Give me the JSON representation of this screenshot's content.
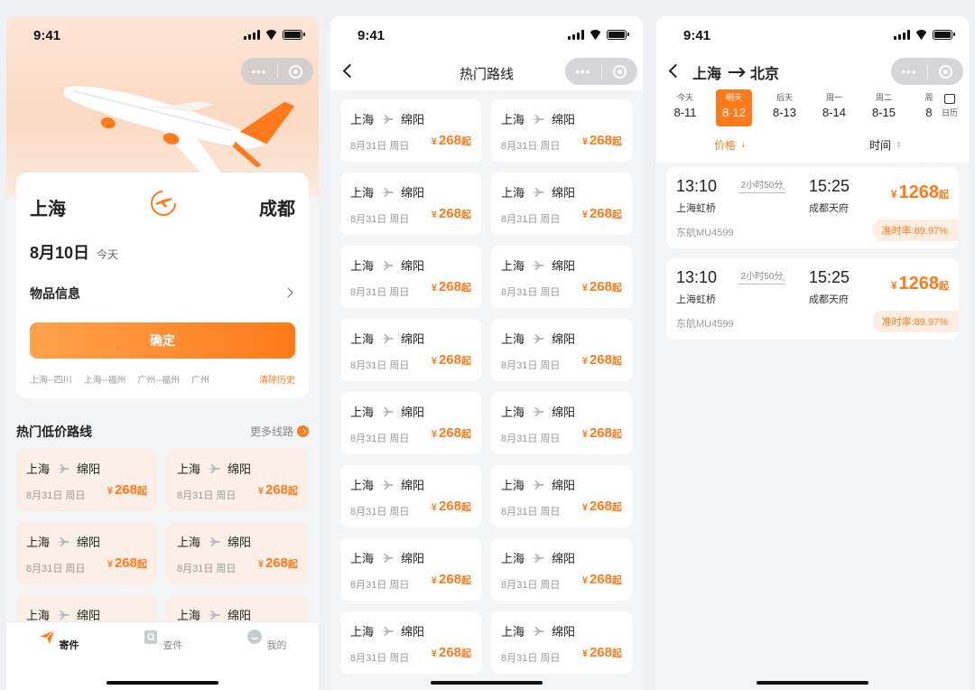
{
  "status": {
    "time": "9:41"
  },
  "colors": {
    "accent": "#ff7a1a",
    "accent_light": "#fbefe7"
  },
  "home": {
    "from_city": "上海",
    "to_city": "成都",
    "date": "8月10日",
    "date_sub": "今天",
    "goods_label": "物品信息",
    "confirm_label": "确定",
    "history": [
      "上海--四川",
      "上海--福州",
      "广州--福州",
      "广州"
    ],
    "clear_history": "清除历史",
    "section_title": "热门低价路线",
    "more_label": "更多线路",
    "routes": [
      {
        "from": "上海",
        "to": "绵阳",
        "date": "8月31日 周日",
        "currency": "¥",
        "price": "268",
        "suffix": "起"
      },
      {
        "from": "上海",
        "to": "绵阳",
        "date": "8月31日 周日",
        "currency": "¥",
        "price": "268",
        "suffix": "起"
      },
      {
        "from": "上海",
        "to": "绵阳",
        "date": "8月31日 周日",
        "currency": "¥",
        "price": "268",
        "suffix": "起"
      },
      {
        "from": "上海",
        "to": "绵阳",
        "date": "8月31日 周日",
        "currency": "¥",
        "price": "268",
        "suffix": "起"
      },
      {
        "from": "上海",
        "to": "绵阳",
        "date": "",
        "currency": "",
        "price": "",
        "suffix": ""
      },
      {
        "from": "上海",
        "to": "绵阳",
        "date": "",
        "currency": "",
        "price": "",
        "suffix": ""
      }
    ],
    "tabs": [
      {
        "label": "寄件",
        "icon": "send-plane-icon"
      },
      {
        "label": "查件",
        "icon": "search-package-icon"
      },
      {
        "label": "我的",
        "icon": "profile-face-icon"
      }
    ]
  },
  "hot_routes": {
    "title": "热门路线",
    "routes": [
      {
        "from": "上海",
        "to": "绵阳",
        "date": "8月31日 周日",
        "currency": "¥",
        "price": "268",
        "suffix": "起"
      },
      {
        "from": "上海",
        "to": "绵阳",
        "date": "8月31日 周日",
        "currency": "¥",
        "price": "268",
        "suffix": "起"
      },
      {
        "from": "上海",
        "to": "绵阳",
        "date": "8月31日 周日",
        "currency": "¥",
        "price": "268",
        "suffix": "起"
      },
      {
        "from": "上海",
        "to": "绵阳",
        "date": "8月31日 周日",
        "currency": "¥",
        "price": "268",
        "suffix": "起"
      },
      {
        "from": "上海",
        "to": "绵阳",
        "date": "8月31日 周日",
        "currency": "¥",
        "price": "268",
        "suffix": "起"
      },
      {
        "from": "上海",
        "to": "绵阳",
        "date": "8月31日 周日",
        "currency": "¥",
        "price": "268",
        "suffix": "起"
      },
      {
        "from": "上海",
        "to": "绵阳",
        "date": "8月31日 周日",
        "currency": "¥",
        "price": "268",
        "suffix": "起"
      },
      {
        "from": "上海",
        "to": "绵阳",
        "date": "8月31日 周日",
        "currency": "¥",
        "price": "268",
        "suffix": "起"
      },
      {
        "from": "上海",
        "to": "绵阳",
        "date": "8月31日 周日",
        "currency": "¥",
        "price": "268",
        "suffix": "起"
      },
      {
        "from": "上海",
        "to": "绵阳",
        "date": "8月31日 周日",
        "currency": "¥",
        "price": "268",
        "suffix": "起"
      },
      {
        "from": "上海",
        "to": "绵阳",
        "date": "8月31日 周日",
        "currency": "¥",
        "price": "268",
        "suffix": "起"
      },
      {
        "from": "上海",
        "to": "绵阳",
        "date": "8月31日 周日",
        "currency": "¥",
        "price": "268",
        "suffix": "起"
      },
      {
        "from": "上海",
        "to": "绵阳",
        "date": "8月31日 周日",
        "currency": "¥",
        "price": "268",
        "suffix": "起"
      },
      {
        "from": "上海",
        "to": "绵阳",
        "date": "8月31日 周日",
        "currency": "¥",
        "price": "268",
        "suffix": "起"
      },
      {
        "from": "上海",
        "to": "绵阳",
        "date": "8月31日 周日",
        "currency": "¥",
        "price": "268",
        "suffix": "起"
      },
      {
        "from": "上海",
        "to": "绵阳",
        "date": "8月31日 周日",
        "currency": "¥",
        "price": "268",
        "suffix": "起"
      }
    ]
  },
  "flights": {
    "from_city": "上海",
    "to_city": "北京",
    "days": [
      {
        "label": "今天",
        "date": "8-11"
      },
      {
        "label": "明天",
        "date": "8-12",
        "selected": true
      },
      {
        "label": "后天",
        "date": "8-13"
      },
      {
        "label": "周一",
        "date": "8-14"
      },
      {
        "label": "周二",
        "date": "8-15"
      },
      {
        "label": "周",
        "date": "8"
      }
    ],
    "calendar_label": "日历",
    "sort_price": "价格",
    "sort_time": "时间",
    "list": [
      {
        "dep_time": "13:10",
        "dep_place": "上海虹桥",
        "duration": "2小时50分",
        "arr_time": "15:25",
        "arr_place": "成都天府",
        "currency": "¥",
        "price": "1268",
        "suffix": "起",
        "flight_no": "东航MU4599",
        "on_time": "准时率:89.97%"
      },
      {
        "dep_time": "13:10",
        "dep_place": "上海虹桥",
        "duration": "2小时50分",
        "arr_time": "15:25",
        "arr_place": "成都天府",
        "currency": "¥",
        "price": "1268",
        "suffix": "起",
        "flight_no": "东航MU4599",
        "on_time": "准时率:89.97%"
      }
    ]
  }
}
